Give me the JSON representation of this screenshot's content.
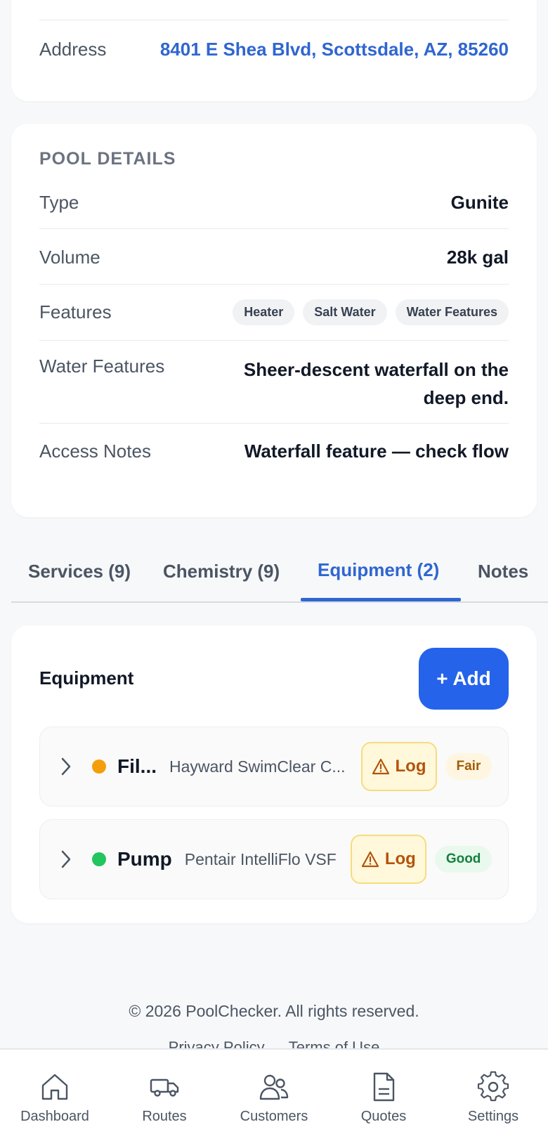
{
  "contact": {
    "address_label": "Address",
    "address_value": "8401 E Shea Blvd, Scottsdale, AZ, 85260"
  },
  "pool": {
    "title": "POOL DETAILS",
    "type_label": "Type",
    "type_value": "Gunite",
    "volume_label": "Volume",
    "volume_value": "28k gal",
    "features_label": "Features",
    "features": [
      "Heater",
      "Salt Water",
      "Water Features"
    ],
    "water_features_label": "Water Features",
    "water_features_value": "Sheer-descent waterfall on the deep end.",
    "access_label": "Access Notes",
    "access_value": "Waterfall feature — check flow"
  },
  "tabs": [
    {
      "label": "Services (9)"
    },
    {
      "label": "Chemistry (9)"
    },
    {
      "label": "Equipment (2)"
    },
    {
      "label": "Notes"
    }
  ],
  "equipment": {
    "title": "Equipment",
    "add_label": "+ Add",
    "items": [
      {
        "name": "Fil...",
        "model": "Hayward SwimClear C...",
        "log_label": "Log",
        "status": "Fair",
        "status_color": "#f59e0b"
      },
      {
        "name": "Pump",
        "model": "Pentair IntelliFlo VSF",
        "log_label": "Log",
        "status": "Good",
        "status_color": "#22c55e"
      }
    ]
  },
  "footer": {
    "copyright": "© 2026 PoolChecker. All rights reserved.",
    "privacy": "Privacy Policy",
    "terms": "Terms of Use"
  },
  "nav": [
    {
      "label": "Dashboard",
      "icon": "home-icon"
    },
    {
      "label": "Routes",
      "icon": "truck-icon"
    },
    {
      "label": "Customers",
      "icon": "users-icon"
    },
    {
      "label": "Quotes",
      "icon": "document-icon"
    },
    {
      "label": "Settings",
      "icon": "gear-icon"
    }
  ],
  "colors": {
    "accent": "#2563eb",
    "link": "#2f66d0",
    "warning_bg": "#fff8db"
  }
}
